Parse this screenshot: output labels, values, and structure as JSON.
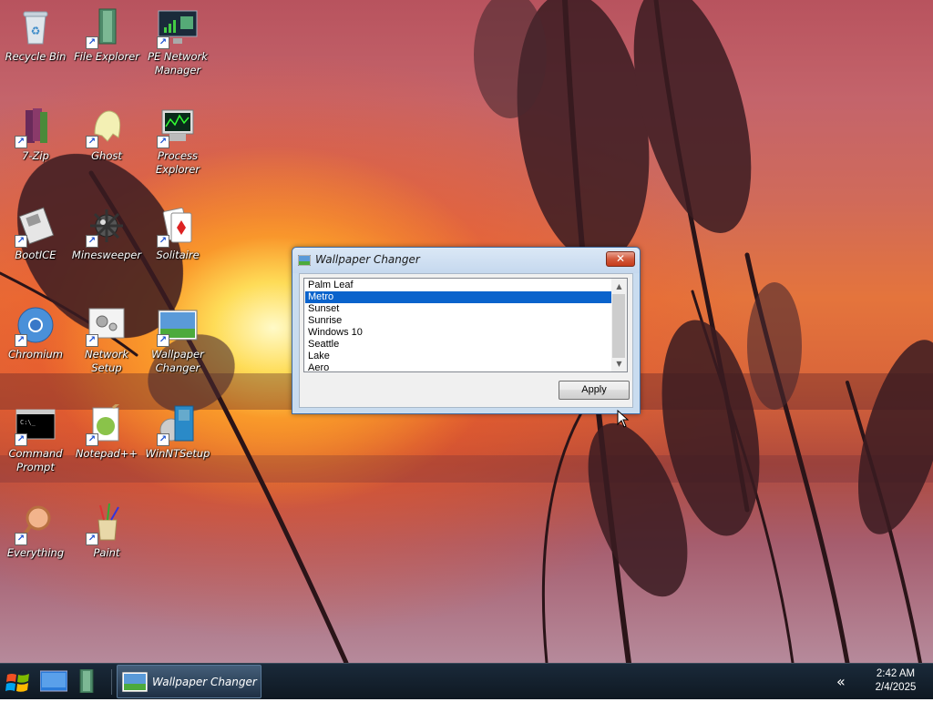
{
  "desktop": {
    "icons": [
      {
        "label": "Recycle Bin",
        "icon": "recycle-bin-icon"
      },
      {
        "label": "File Explorer",
        "icon": "file-explorer-icon"
      },
      {
        "label": "PE Network Manager",
        "icon": "network-manager-icon"
      },
      {
        "label": "7-Zip",
        "icon": "7zip-icon"
      },
      {
        "label": "Ghost",
        "icon": "ghost-icon"
      },
      {
        "label": "Process Explorer",
        "icon": "process-explorer-icon"
      },
      {
        "label": "BootICE",
        "icon": "bootice-icon"
      },
      {
        "label": "Minesweeper",
        "icon": "minesweeper-icon"
      },
      {
        "label": "Solitaire",
        "icon": "solitaire-icon"
      },
      {
        "label": "Chromium",
        "icon": "chromium-icon"
      },
      {
        "label": "Network Setup",
        "icon": "network-setup-icon"
      },
      {
        "label": "Wallpaper Changer",
        "icon": "wallpaper-changer-icon"
      },
      {
        "label": "Command Prompt",
        "icon": "command-prompt-icon"
      },
      {
        "label": "Notepad++",
        "icon": "notepadpp-icon"
      },
      {
        "label": "WinNTSetup",
        "icon": "winntsetup-icon"
      },
      {
        "label": "Everything",
        "icon": "everything-icon"
      },
      {
        "label": "Paint",
        "icon": "paint-icon"
      }
    ]
  },
  "window": {
    "title": "Wallpaper Changer",
    "close_glyph": "✕",
    "list": {
      "items": [
        "Palm Leaf",
        "Metro",
        "Sunset",
        "Sunrise",
        "Windows 10",
        "Seattle",
        "Lake",
        "Aero"
      ],
      "selected": "Metro"
    },
    "apply_label": "Apply"
  },
  "taskbar": {
    "task_label": "Wallpaper Changer",
    "tray_chevron": "«",
    "time": "2:42 AM",
    "date": "2/4/2025"
  },
  "colors": {
    "selection": "#0a63cc",
    "taskbar": "#0f1822"
  }
}
